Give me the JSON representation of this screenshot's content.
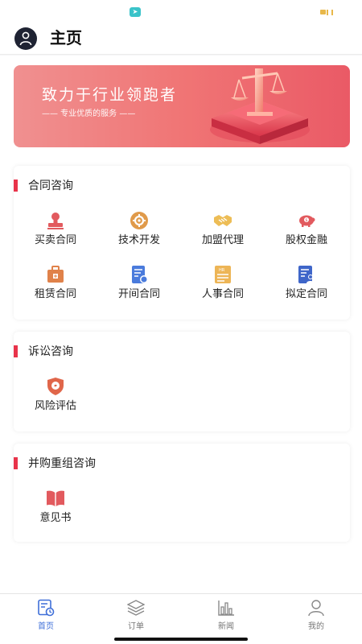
{
  "header": {
    "title": "主页"
  },
  "banner": {
    "title": "致力于行业领跑者",
    "subtitle": "——  专业优质的服务  ——"
  },
  "sections": [
    {
      "title": "合同咨询",
      "items": [
        {
          "label": "买卖合同",
          "icon": "stamp-icon"
        },
        {
          "label": "技术开发",
          "icon": "gear-icon"
        },
        {
          "label": "加盟代理",
          "icon": "handshake-icon"
        },
        {
          "label": "股权金融",
          "icon": "piggy-bank-icon"
        },
        {
          "label": "租赁合同",
          "icon": "briefcase-icon"
        },
        {
          "label": "开间合同",
          "icon": "document-icon"
        },
        {
          "label": "人事合同",
          "icon": "hr-document-icon"
        },
        {
          "label": "拟定合同",
          "icon": "user-document-icon"
        }
      ]
    },
    {
      "title": "诉讼咨询",
      "items": [
        {
          "label": "风险评估",
          "icon": "shield-icon"
        }
      ]
    },
    {
      "title": "并购重组咨询",
      "items": [
        {
          "label": "意见书",
          "icon": "book-icon"
        }
      ]
    }
  ],
  "tabbar": {
    "items": [
      {
        "label": "首页",
        "icon": "home-icon",
        "active": true
      },
      {
        "label": "订单",
        "icon": "layers-icon",
        "active": false
      },
      {
        "label": "新闻",
        "icon": "bar-chart-icon",
        "active": false
      },
      {
        "label": "我的",
        "icon": "user-icon",
        "active": false
      }
    ]
  },
  "colors": {
    "accent": "#e8334a",
    "active_tab": "#3f6fd8",
    "banner_start": "#f09090",
    "banner_end": "#ea5a66"
  }
}
